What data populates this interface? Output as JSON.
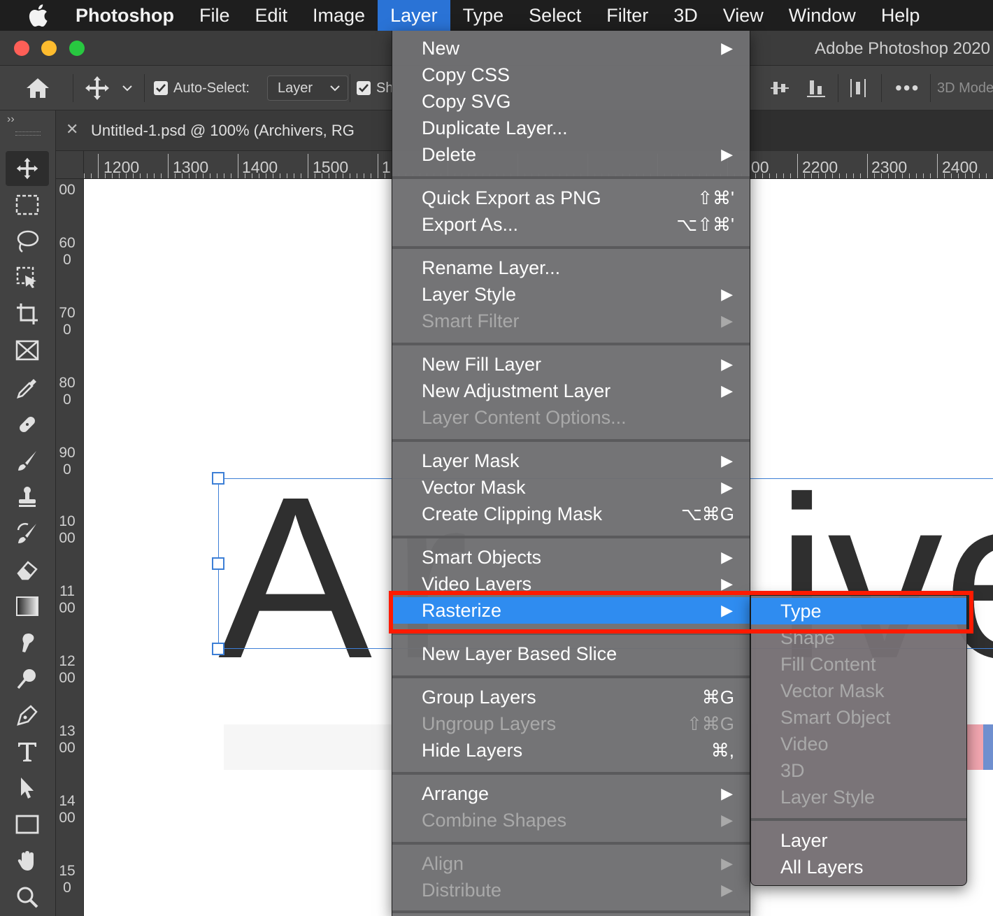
{
  "menubar": {
    "app": "Photoshop",
    "items": [
      "File",
      "Edit",
      "Image",
      "Layer",
      "Type",
      "Select",
      "Filter",
      "3D",
      "View",
      "Window",
      "Help"
    ],
    "active": "Layer"
  },
  "window": {
    "title": "Adobe Photoshop 2020"
  },
  "options_bar": {
    "auto_select_label": "Auto-Select:",
    "auto_select_value": "Layer",
    "show_label_partial": "Sh",
    "mode_label_partial": "3D Mode"
  },
  "document": {
    "tab_title": "Untitled-1.psd @ 100% (Archivers, RG"
  },
  "rulers": {
    "h_left": [
      "1200",
      "1300",
      "1400",
      "1500",
      "1"
    ],
    "h_right": [
      "00",
      "2200",
      "2300",
      "2400"
    ],
    "v": [
      "00",
      "600",
      "700",
      "800",
      "900",
      "1000",
      "1100",
      "1200",
      "1300",
      "1400",
      "150"
    ]
  },
  "canvas": {
    "text_left": "A",
    "text_mid": "r",
    "text_right": "ive"
  },
  "layer_menu": {
    "items": {
      "new": "New",
      "copy_css": "Copy CSS",
      "copy_svg": "Copy SVG",
      "duplicate": "Duplicate Layer...",
      "delete": "Delete",
      "quick_export": "Quick Export as PNG",
      "quick_export_sc": "⇧⌘'",
      "export_as": "Export As...",
      "export_as_sc": "⌥⇧⌘'",
      "rename": "Rename Layer...",
      "layer_style": "Layer Style",
      "smart_filter": "Smart Filter",
      "new_fill": "New Fill Layer",
      "new_adjustment": "New Adjustment Layer",
      "content_options": "Layer Content Options...",
      "layer_mask": "Layer Mask",
      "vector_mask": "Vector Mask",
      "clipping_mask": "Create Clipping Mask",
      "clipping_mask_sc": "⌥⌘G",
      "smart_objects": "Smart Objects",
      "video_layers": "Video Layers",
      "rasterize": "Rasterize",
      "slice": "New Layer Based Slice",
      "group": "Group Layers",
      "group_sc": "⌘G",
      "ungroup": "Ungroup Layers",
      "ungroup_sc": "⇧⌘G",
      "hide": "Hide Layers",
      "hide_sc": "⌘,",
      "arrange": "Arrange",
      "combine": "Combine Shapes",
      "align": "Align",
      "distribute": "Distribute"
    },
    "arrow": "▶"
  },
  "rasterize_submenu": {
    "type": "Type",
    "shape": "Shape",
    "fill_content": "Fill Content",
    "vector_mask": "Vector Mask",
    "smart_object": "Smart Object",
    "video": "Video",
    "three_d": "3D",
    "layer_style": "Layer Style",
    "layer": "Layer",
    "all_layers": "All Layers"
  },
  "colors": {
    "menu_highlight": "#2f8cf0",
    "annotation_box": "#ff1a00",
    "menubar_active": "#2a73d6"
  }
}
